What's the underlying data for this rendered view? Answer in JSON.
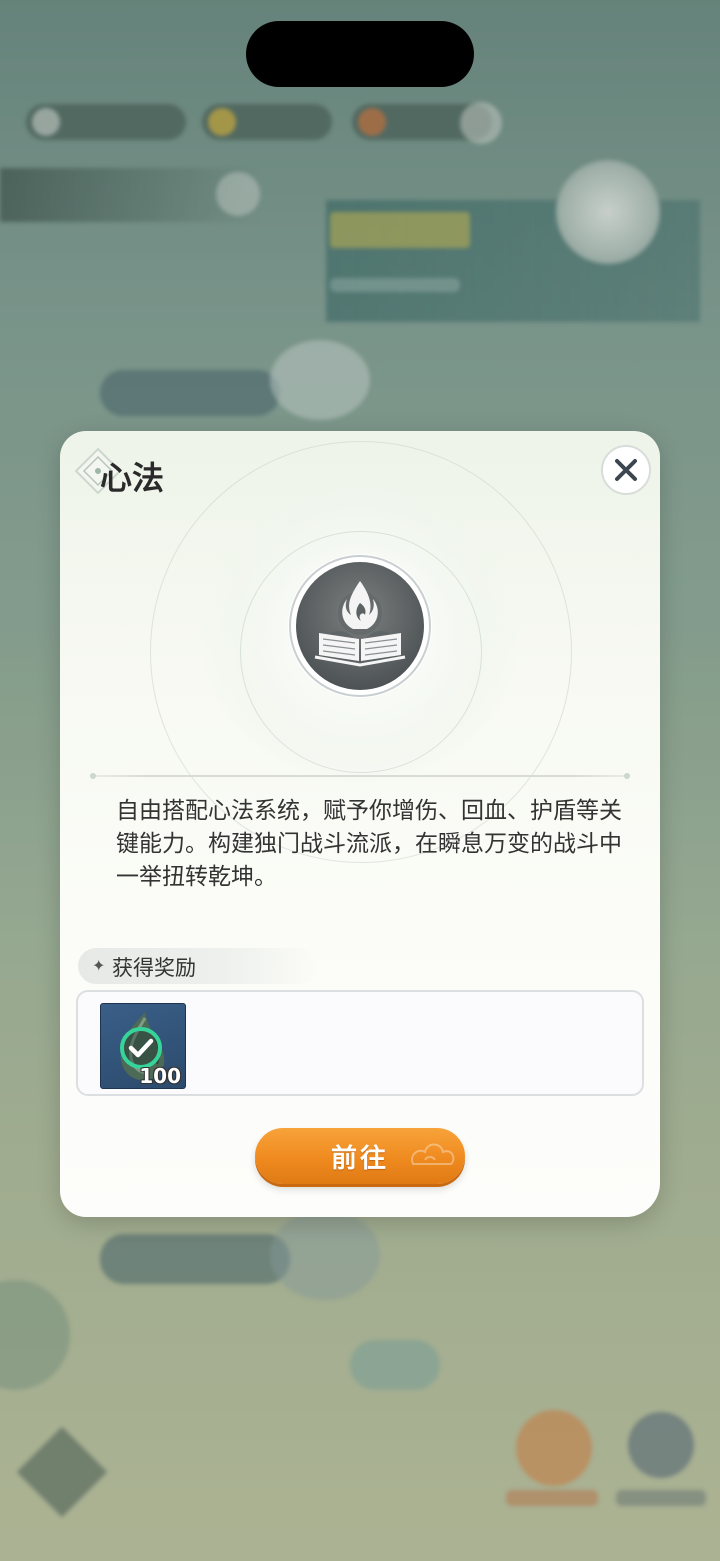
{
  "dialog": {
    "title": "心法",
    "description": "自由搭配心法系统，赋予你增伤、回血、护盾等关键能力。构建独门战斗流派，在瞬息万变的战斗中一举扭转乾坤。",
    "emblem_icon": "flame-book-icon",
    "close_icon": "close-icon",
    "reward_section": {
      "label": "获得奖励",
      "items": [
        {
          "icon": "skill-stone-icon",
          "count": "100",
          "claimed_icon": "check-badge-icon"
        }
      ]
    },
    "go_button": {
      "label": "前往"
    }
  },
  "colors": {
    "accent_orange": "#ef8a1f",
    "item_bg": "#2c4a6c",
    "check_green": "#36d49b"
  }
}
